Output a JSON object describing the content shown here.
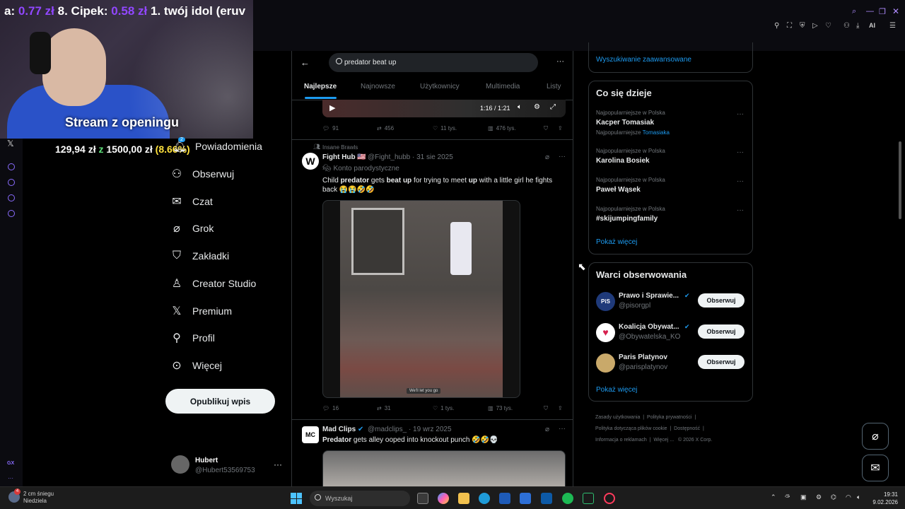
{
  "overlay": {
    "ticker": {
      "prefix": "a:",
      "v1": "0.77 zł",
      "item2": "8. Cipek:",
      "v2": "0.58 zł",
      "item3": "1. twój idol (eruv"
    },
    "stream_label": "Stream z openingu",
    "goal": {
      "current": "129,94 zł",
      "z": "z",
      "target": "1500,00 zł",
      "pct": "(8.66%)"
    }
  },
  "nav": {
    "notif_badge": "2",
    "items": [
      {
        "label": "Powiadomienia",
        "icon": "bell-icon"
      },
      {
        "label": "Obserwuj",
        "icon": "person-plus-icon"
      },
      {
        "label": "Czat",
        "icon": "mail-icon"
      },
      {
        "label": "Grok",
        "icon": "grok-icon"
      },
      {
        "label": "Zakładki",
        "icon": "bookmark-icon"
      },
      {
        "label": "Creator Studio",
        "icon": "creator-icon"
      },
      {
        "label": "Premium",
        "icon": "x-icon"
      },
      {
        "label": "Profil",
        "icon": "person-icon"
      },
      {
        "label": "Więcej",
        "icon": "more-circle-icon"
      }
    ],
    "post_button": "Opublikuj wpis",
    "user": {
      "name": "Hubert",
      "handle": "@Hubert53569753"
    }
  },
  "search": {
    "query": "predator beat up",
    "tabs": [
      "Najlepsze",
      "Najnowsze",
      "Użytkownicy",
      "Multimedia",
      "Listy"
    ]
  },
  "tweets": {
    "t0": {
      "time": "1:16 / 1:21",
      "replies": "91",
      "retweets": "456",
      "likes": "11 tys.",
      "views": "476 tys."
    },
    "t1": {
      "context": "Insane Brawls",
      "name": "Fight Hub 🇺🇸",
      "handle": "@Fight_hubb · 31 sie 2025",
      "label": "Konto parodystyczne",
      "text_a": "Child ",
      "text_b": "predator",
      "text_c": " gets ",
      "text_d": "beat up",
      "text_e": " for trying to meet ",
      "text_f": "up",
      "text_g": " with a little girl he fights back 😭😭🤣🤣",
      "caption": "We'll let you go",
      "replies": "16",
      "retweets": "31",
      "likes": "1 tys.",
      "views": "73 tys."
    },
    "t2": {
      "name": "Mad Clips",
      "handle": "@madclips_ · 19 wrz 2025",
      "text_a": "Predator",
      "text_b": " gets alley ooped into knockout punch 🤣🤣💀"
    }
  },
  "right": {
    "advanced_search": "Wyszukiwanie zaawansowane",
    "trends_title": "Co się dzieje",
    "trends": [
      {
        "context": "Najpopularniejsze w Polska",
        "title": "Kacper Tomasiak",
        "extra_prefix": "Najpopularniejsze",
        "extra_link": "Tomasiaka"
      },
      {
        "context": "Najpopularniejsze w Polska",
        "title": "Karolina Bosiek"
      },
      {
        "context": "Najpopularniejsze w Polska",
        "title": "Paweł Wąsek"
      },
      {
        "context": "Najpopularniejsze w Polska",
        "title": "#skijumpingfamily"
      }
    ],
    "show_more": "Pokaż więcej",
    "follow_title": "Warci obserwowania",
    "follow": [
      {
        "name": "Prawo i Sprawie...",
        "handle": "@pisorgpl",
        "btn": "Obserwuj"
      },
      {
        "name": "Koalicja Obywat...",
        "handle": "@Obywatelska_KO",
        "btn": "Obserwuj"
      },
      {
        "name": "Paris Platynov",
        "handle": "@parisplatynov",
        "btn": "Obserwuj"
      }
    ],
    "show_more2": "Pokaż więcej",
    "footer": {
      "l1": "Zasady użytkowania",
      "l2": "Polityka prywatności",
      "l3": "Polityka dotycząca plików cookie",
      "l4": "Dostępność",
      "l5": "Informacja o reklamach",
      "l6": "Więcej ...",
      "l7": "© 2026 X Corp."
    }
  },
  "taskbar": {
    "weather_a": "2 cm śniegu",
    "weather_b": "Niedziela",
    "weather_badge": "4",
    "search": "Wyszukaj",
    "time": "19:31",
    "date": "9.02.2026"
  },
  "browser": {
    "gx_label": "GX",
    "ai_label": "AI"
  }
}
